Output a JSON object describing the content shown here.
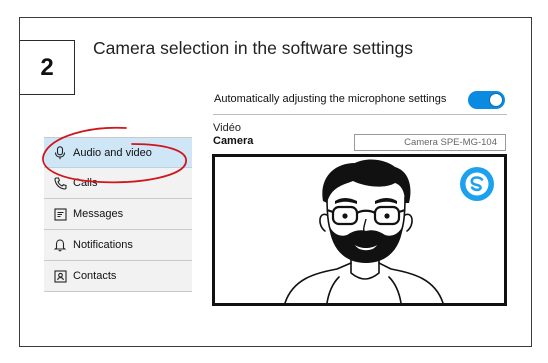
{
  "step": {
    "number": "2"
  },
  "title": "Camera selection in the software settings",
  "microphone": {
    "label": "Automatically adjusting the microphone settings",
    "enabled": true
  },
  "video": {
    "section_label": "Vidéo",
    "camera_label": "Camera",
    "camera_selected": "Camera SPE-MG-104"
  },
  "menu": {
    "items": [
      {
        "label": "Audio and video",
        "icon": "microphone-icon",
        "active": true
      },
      {
        "label": "Calls",
        "icon": "phone-icon",
        "active": false
      },
      {
        "label": "Messages",
        "icon": "message-icon",
        "active": false
      },
      {
        "label": "Notifications",
        "icon": "bell-icon",
        "active": false
      },
      {
        "label": "Contacts",
        "icon": "contact-card-icon",
        "active": false
      }
    ]
  },
  "colors": {
    "accent": "#0a8ae0",
    "active_menu_bg": "#cfe6f7",
    "annotation_red": "#d0161c",
    "skype_blue": "#1ba1ee"
  }
}
